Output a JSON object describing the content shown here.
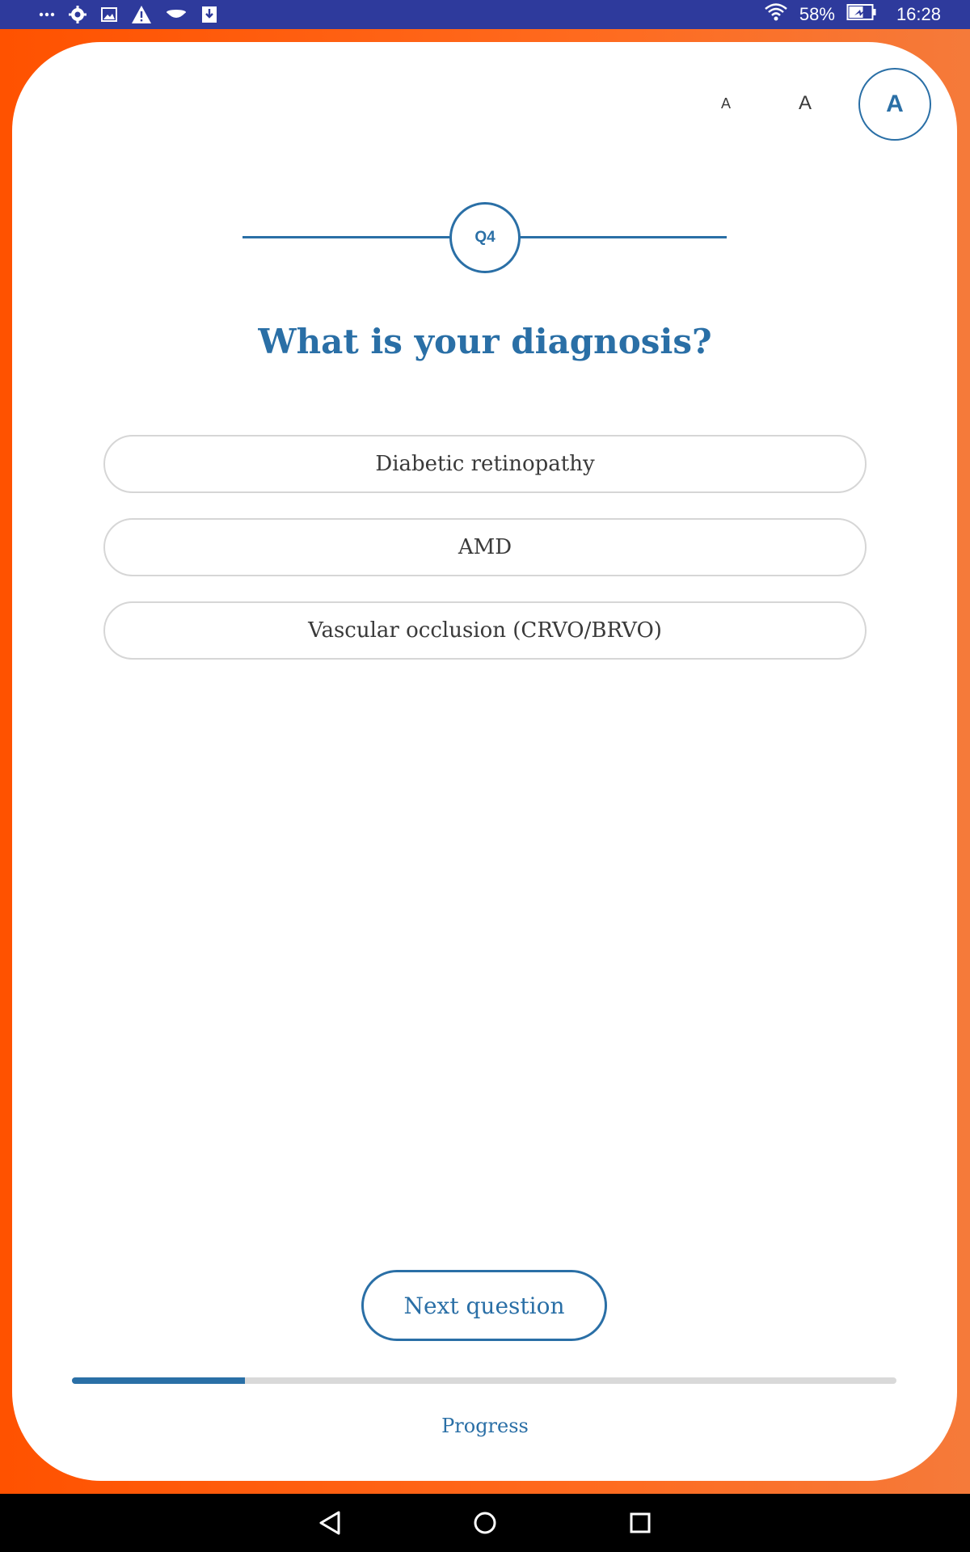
{
  "status_bar": {
    "battery_percent": "58%",
    "time": "16:28",
    "left_icons": [
      "more-icon",
      "settings-icon",
      "image-icon",
      "warning-icon",
      "dish-icon",
      "download-icon"
    ],
    "right_icons": [
      "wifi-icon",
      "battery-charging-icon"
    ]
  },
  "font_controls": {
    "small_label": "A",
    "medium_label": "A",
    "large_label": "A",
    "selected": "large"
  },
  "question": {
    "number_label": "Q4",
    "title": "What is your diagnosis?"
  },
  "options": [
    {
      "label": "Diabetic retinopathy"
    },
    {
      "label": "AMD"
    },
    {
      "label": "Vascular occlusion (CRVO/BRVO)"
    }
  ],
  "next_button_label": "Next question",
  "progress": {
    "label": "Progress",
    "fraction": 0.21
  },
  "colors": {
    "accent": "#2a6fa6",
    "background_orange": "#ff5a0a",
    "status_bar": "#2e3a9c",
    "text": "#3a3a3a"
  }
}
